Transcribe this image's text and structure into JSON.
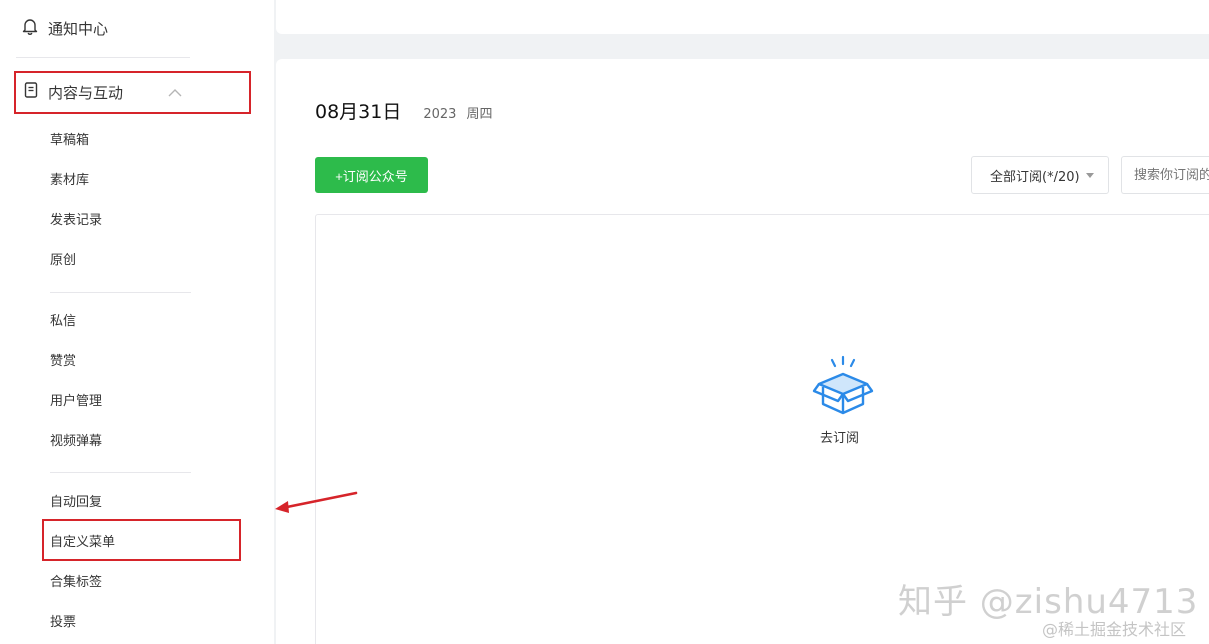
{
  "sidebar": {
    "notification": "通知中心",
    "group_label": "内容与互动",
    "items_a": [
      "草稿箱",
      "素材库",
      "发表记录",
      "原创"
    ],
    "items_b": [
      "私信",
      "赞赏",
      "用户管理",
      "视频弹幕"
    ],
    "items_c": [
      "自动回复",
      "自定义菜单",
      "合集标签",
      "投票"
    ]
  },
  "main": {
    "date": "08月31日",
    "year": "2023",
    "weekday": "周四",
    "subscribe_button": "+订阅公众号",
    "filter_label": "全部订阅(*/20)",
    "search_placeholder": "搜索你订阅的",
    "empty_label": "去订阅"
  },
  "watermark": {
    "primary": "知乎 @zishu4713",
    "secondary": "@稀土掘金技术社区"
  },
  "colors": {
    "accent": "#2dbb4b",
    "annotation": "#d6242a",
    "icon_blue": "#2b8ae8"
  },
  "icons": [
    "bell-icon",
    "document-icon",
    "chevron-up-icon",
    "caret-down-icon",
    "open-box-icon",
    "arrow-annotation"
  ]
}
